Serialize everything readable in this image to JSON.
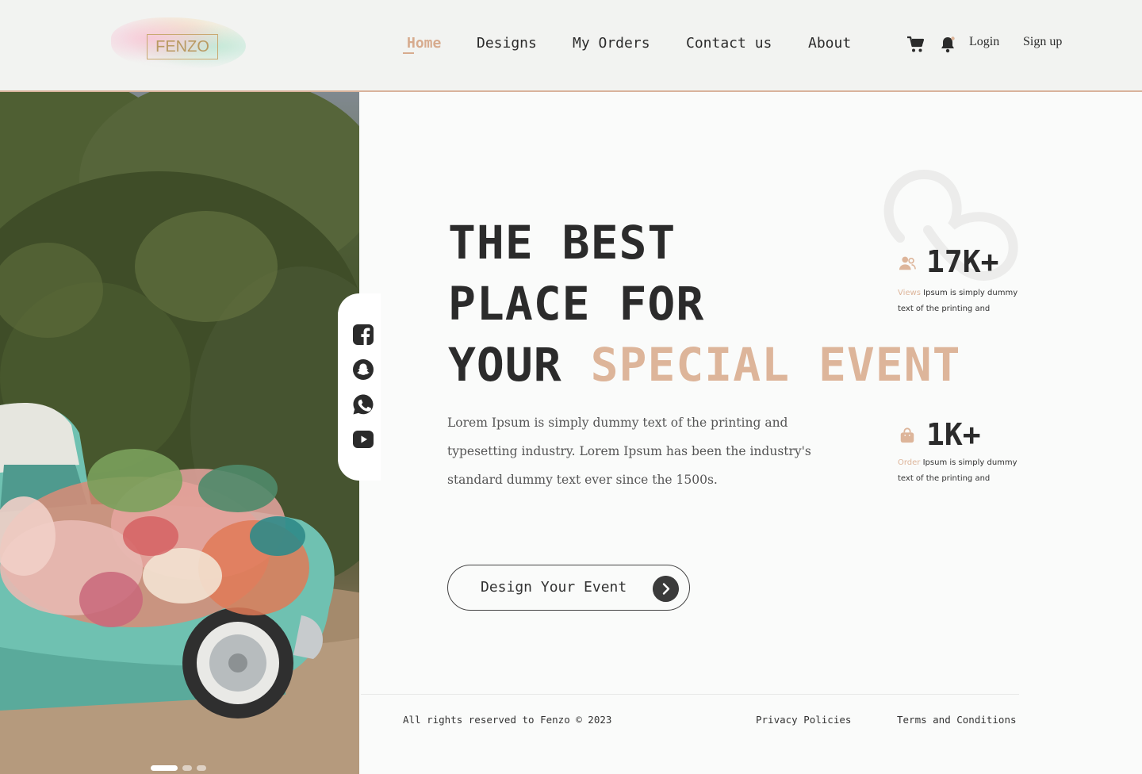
{
  "brand": {
    "name": "FENZO"
  },
  "nav": {
    "items": [
      {
        "label": "Home",
        "active": true
      },
      {
        "label": "Designs"
      },
      {
        "label": "My Orders"
      },
      {
        "label": "Contact us"
      },
      {
        "label": "About"
      }
    ]
  },
  "header_actions": {
    "cart_icon": "cart-icon",
    "bell_icon": "bell-icon",
    "login_label": "Login",
    "signup_label": "Sign up"
  },
  "hero": {
    "line1": "THE BEST",
    "line2": "PLACE FOR",
    "line3_plain": "YOUR",
    "line3_accent": "SPECIAL EVENT",
    "description_lines": [
      "Lorem Ipsum is simply dummy text of the printing and",
      "typesetting industry. Lorem Ipsum has been the industry's",
      "standard dummy text ever since the 1500s."
    ],
    "cta_label": "Design Your Event"
  },
  "stats": [
    {
      "icon": "users-icon",
      "value": "17K+",
      "tag": "Views",
      "desc_line1": "Ipsum is simply dummy",
      "desc_line2": "text of the printing and"
    },
    {
      "icon": "shopping-bag-icon",
      "value": "1K+",
      "tag": "Order",
      "desc_line1": "Ipsum is simply dummy",
      "desc_line2": "text of the printing and"
    }
  ],
  "social": [
    "facebook-icon",
    "snapchat-icon",
    "whatsapp-icon",
    "youtube-icon"
  ],
  "carousel": {
    "slides": 3,
    "active_slide": 1
  },
  "footer": {
    "copyright": "All rights reserved to Fenzo  © 2023",
    "privacy": "Privacy Policies",
    "terms": "Terms and Conditions"
  },
  "colors": {
    "accent": "#ddb59a",
    "text": "#2b2b2b",
    "background": "#fafbfa",
    "header_bg": "#f2f3f1"
  }
}
